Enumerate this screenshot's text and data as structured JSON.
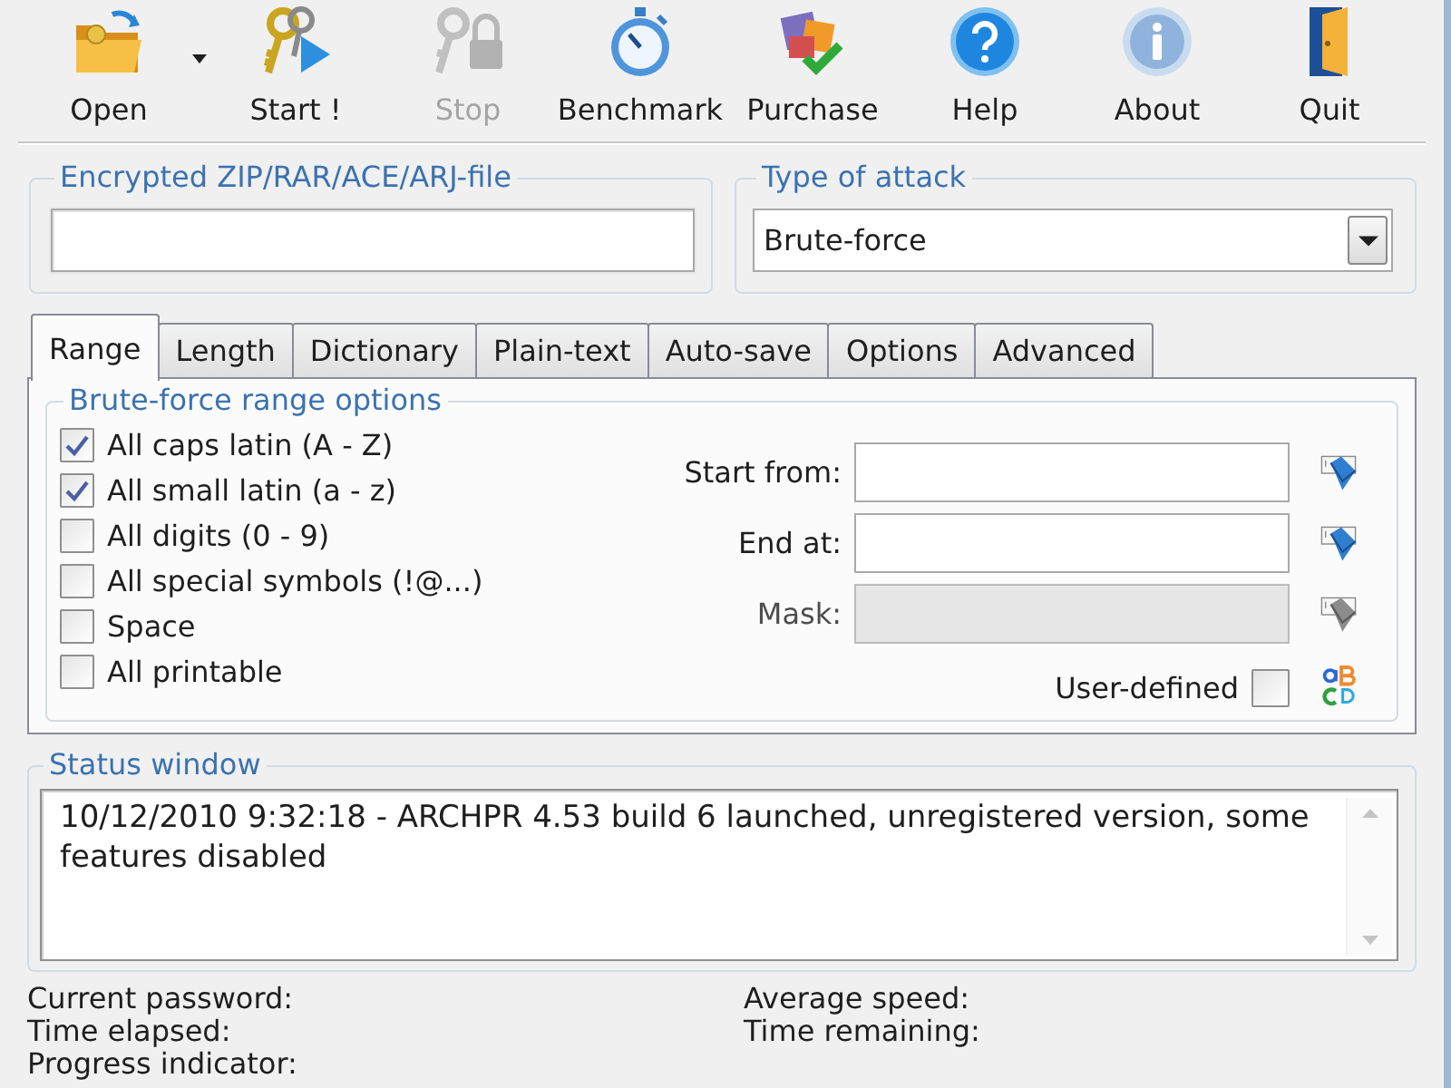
{
  "toolbar": [
    {
      "label": "Open",
      "disabled": false,
      "dropdown": true
    },
    {
      "label": "Start !",
      "disabled": false,
      "dropdown": false
    },
    {
      "label": "Stop",
      "disabled": true,
      "dropdown": false
    },
    {
      "label": "Benchmark",
      "disabled": false,
      "dropdown": false
    },
    {
      "label": "Purchase",
      "disabled": false,
      "dropdown": false
    },
    {
      "label": "Help",
      "disabled": false,
      "dropdown": false
    },
    {
      "label": "About",
      "disabled": false,
      "dropdown": false
    },
    {
      "label": "Quit",
      "disabled": false,
      "dropdown": false
    }
  ],
  "file_group": {
    "title": "Encrypted ZIP/RAR/ACE/ARJ-file"
  },
  "attack_group": {
    "title": "Type of attack",
    "value": "Brute-force"
  },
  "tabs": [
    {
      "label": "Range",
      "selected": true
    },
    {
      "label": "Length",
      "selected": false
    },
    {
      "label": "Dictionary",
      "selected": false
    },
    {
      "label": "Plain-text",
      "selected": false
    },
    {
      "label": "Auto-save",
      "selected": false
    },
    {
      "label": "Options",
      "selected": false
    },
    {
      "label": "Advanced",
      "selected": false
    }
  ],
  "range_group": {
    "title": "Brute-force range options",
    "charsets": [
      {
        "label": "All caps latin (A - Z)",
        "checked": true
      },
      {
        "label": "All small latin (a - z)",
        "checked": true
      },
      {
        "label": "All digits (0 - 9)",
        "checked": false
      },
      {
        "label": "All special symbols (!@...)",
        "checked": false
      },
      {
        "label": "Space",
        "checked": false
      },
      {
        "label": "All printable",
        "checked": false
      }
    ],
    "fields": [
      {
        "label": "Start from:",
        "disabled": false
      },
      {
        "label": "End at:",
        "disabled": false
      },
      {
        "label": "Mask:",
        "disabled": true
      }
    ],
    "user_defined": {
      "label": "User-defined",
      "checked": false
    }
  },
  "status_window": {
    "title": "Status window",
    "message": "10/12/2010 9:32:18 - ARCHPR 4.53 build 6 launched, unregistered version, some features disabled"
  },
  "stats": [
    {
      "label": "Current password:"
    },
    {
      "label": "Average speed:"
    },
    {
      "label": "Time elapsed:"
    },
    {
      "label": "Time remaining:"
    },
    {
      "label": "Progress indicator:"
    }
  ]
}
